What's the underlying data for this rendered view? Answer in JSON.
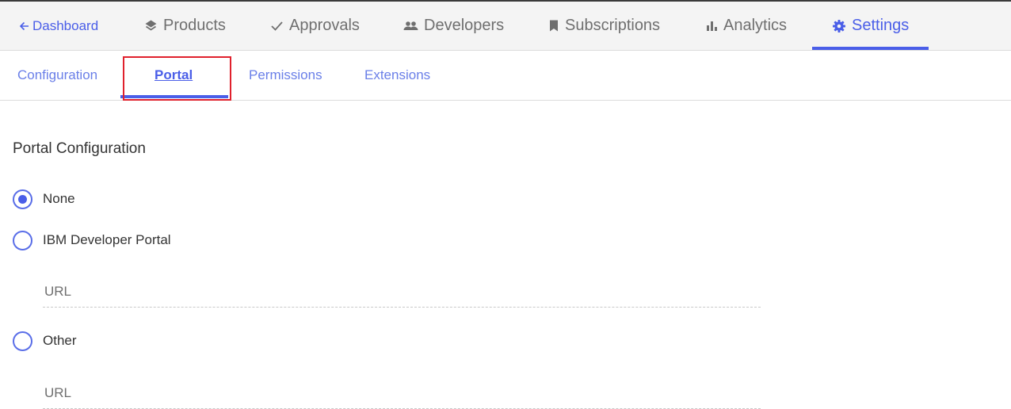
{
  "topnav": {
    "back_label": "Dashboard",
    "items": [
      {
        "label": "Products",
        "icon": "layers-icon"
      },
      {
        "label": "Approvals",
        "icon": "checkmark-icon"
      },
      {
        "label": "Developers",
        "icon": "people-icon"
      },
      {
        "label": "Subscriptions",
        "icon": "bookmark-icon"
      },
      {
        "label": "Analytics",
        "icon": "bar-chart-icon"
      },
      {
        "label": "Settings",
        "icon": "gear-icon",
        "active": true
      }
    ]
  },
  "subnav": {
    "tabs": [
      {
        "label": "Configuration"
      },
      {
        "label": "Portal",
        "active": true
      },
      {
        "label": "Permissions"
      },
      {
        "label": "Extensions"
      }
    ]
  },
  "portal_config": {
    "title": "Portal Configuration",
    "options": [
      {
        "label": "None",
        "selected": true
      },
      {
        "label": "IBM Developer Portal",
        "selected": false
      },
      {
        "label": "Other",
        "selected": false
      }
    ],
    "ibm_url_placeholder": "URL",
    "ibm_url_value": "",
    "other_url_placeholder": "URL",
    "other_url_value": ""
  },
  "colors": {
    "accent": "#4a5ee8",
    "focus_outline": "#e0212d",
    "nav_background": "#f4f4f4"
  }
}
